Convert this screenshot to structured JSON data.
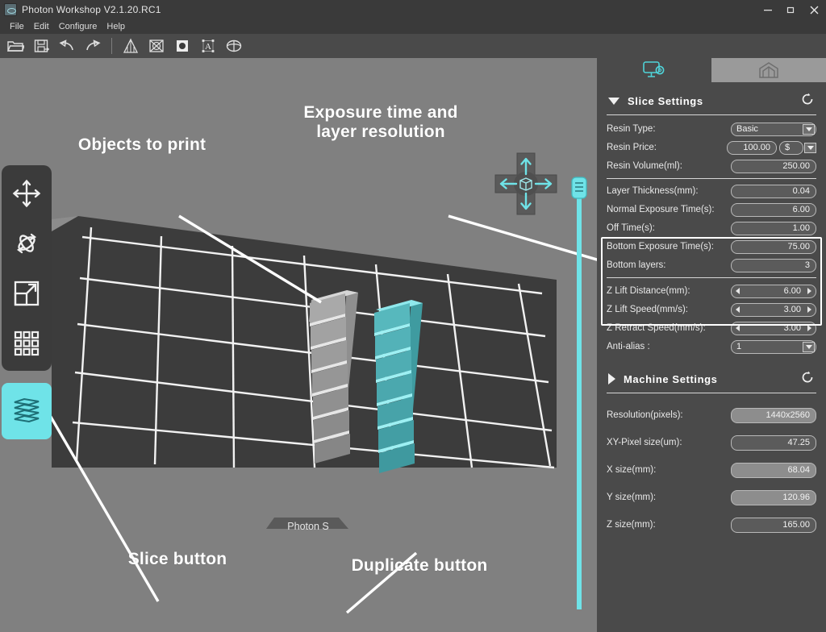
{
  "window": {
    "title": "Photon Workshop V2.1.20.RC1",
    "app_icon": "photon-app-icon",
    "minimize": "—",
    "maximize": "❐",
    "close": "✕"
  },
  "menubar": {
    "items": [
      {
        "label": "File"
      },
      {
        "label": "Edit"
      },
      {
        "label": "Configure"
      },
      {
        "label": "Help"
      }
    ]
  },
  "toolbar": {
    "buttons": [
      {
        "name": "open-file-icon",
        "title": "Open"
      },
      {
        "name": "save-file-icon",
        "title": "Save"
      },
      {
        "name": "undo-icon",
        "title": "Undo"
      },
      {
        "name": "redo-icon",
        "title": "Redo"
      },
      {
        "name": "supports-icon",
        "title": "Supports"
      },
      {
        "name": "mesh-repair-icon",
        "title": "Mesh repair"
      },
      {
        "name": "hollow-icon",
        "title": "Hollow"
      },
      {
        "name": "text-icon",
        "title": "Text"
      },
      {
        "name": "slice-preview-icon",
        "title": "Cut"
      }
    ]
  },
  "viewport": {
    "plate_label": "Photon S",
    "left_tools": [
      {
        "name": "move-tool",
        "label": "Move"
      },
      {
        "name": "rotate-tool",
        "label": "Rotate"
      },
      {
        "name": "scale-tool",
        "label": "Scale"
      },
      {
        "name": "duplicate-tool",
        "label": "Duplicate"
      }
    ],
    "slice_tool": {
      "name": "slice-tool",
      "label": "Slice"
    },
    "nav_gizmo": {
      "name": "view-navigation-gizmo",
      "label": "View cube"
    },
    "z_slider": {
      "name": "z-layer-slider",
      "value": "100"
    },
    "models": [
      {
        "name": "model-gray",
        "color": "#b5b5b5",
        "selected": false
      },
      {
        "name": "model-selected",
        "color": "#5ec8cd",
        "selected": true
      }
    ]
  },
  "annotations": [
    {
      "id": "objects-to-print",
      "text": "Objects to print"
    },
    {
      "id": "exposure-layer",
      "text": "Exposure time and\nlayer resolution"
    },
    {
      "id": "slice-button",
      "text": "Slice button"
    },
    {
      "id": "duplicate-button",
      "text": "Duplicate button"
    }
  ],
  "panel": {
    "tabs": [
      {
        "name": "tab-slice-settings",
        "icon": "monitor-gear-icon",
        "active": true
      },
      {
        "name": "tab-machine",
        "icon": "printer-house-icon",
        "active": false
      }
    ],
    "slice_section": {
      "title": "Slice Settings",
      "expanded": true,
      "refresh_icon": "refresh-icon",
      "rows": [
        {
          "label": "Resin Type:",
          "value": "Basic",
          "control": "combo"
        },
        {
          "label": "Resin Price:",
          "value": "100.00",
          "currency": "$",
          "control": "price"
        },
        {
          "label": "Resin Volume(ml):",
          "value": "250.00",
          "control": "text"
        },
        {
          "label": "Layer Thickness(mm):",
          "value": "0.04",
          "control": "text",
          "highlighted": true
        },
        {
          "label": "Normal Exposure Time(s):",
          "value": "6.00",
          "control": "text",
          "highlighted": true
        },
        {
          "label": "Off Time(s):",
          "value": "1.00",
          "control": "text",
          "highlighted": true
        },
        {
          "label": "Bottom Exposure Time(s):",
          "value": "75.00",
          "control": "text",
          "highlighted": true
        },
        {
          "label": "Bottom layers:",
          "value": "3",
          "control": "text",
          "highlighted": true
        },
        {
          "label": "Z Lift Distance(mm):",
          "value": "6.00",
          "control": "spin"
        },
        {
          "label": "Z Lift Speed(mm/s):",
          "value": "3.00",
          "control": "spin"
        },
        {
          "label": "Z Retract Speed(mm/s):",
          "value": "3.00",
          "control": "spin"
        },
        {
          "label": "Anti-alias :",
          "value": "1",
          "control": "combo"
        }
      ]
    },
    "machine_section": {
      "title": "Machine Settings",
      "expanded": false,
      "refresh_icon": "refresh-icon",
      "rows": [
        {
          "label": "Resolution(pixels):",
          "value": "1440x2560",
          "readonly": true
        },
        {
          "label": "XY-Pixel size(um):",
          "value": "47.25",
          "readonly": false
        },
        {
          "label": "X size(mm):",
          "value": "68.04",
          "readonly": true
        },
        {
          "label": "Y size(mm):",
          "value": "120.96",
          "readonly": true
        },
        {
          "label": "Z size(mm):",
          "value": "165.00",
          "readonly": false
        }
      ]
    }
  },
  "colors": {
    "accent": "#6fe3e8",
    "panel_bg": "#4a4a4a",
    "chrome_bg": "#3a3a3a",
    "viewport_bg": "#808080",
    "plate": "#3c3c3c",
    "annotation": "#ffffff"
  }
}
